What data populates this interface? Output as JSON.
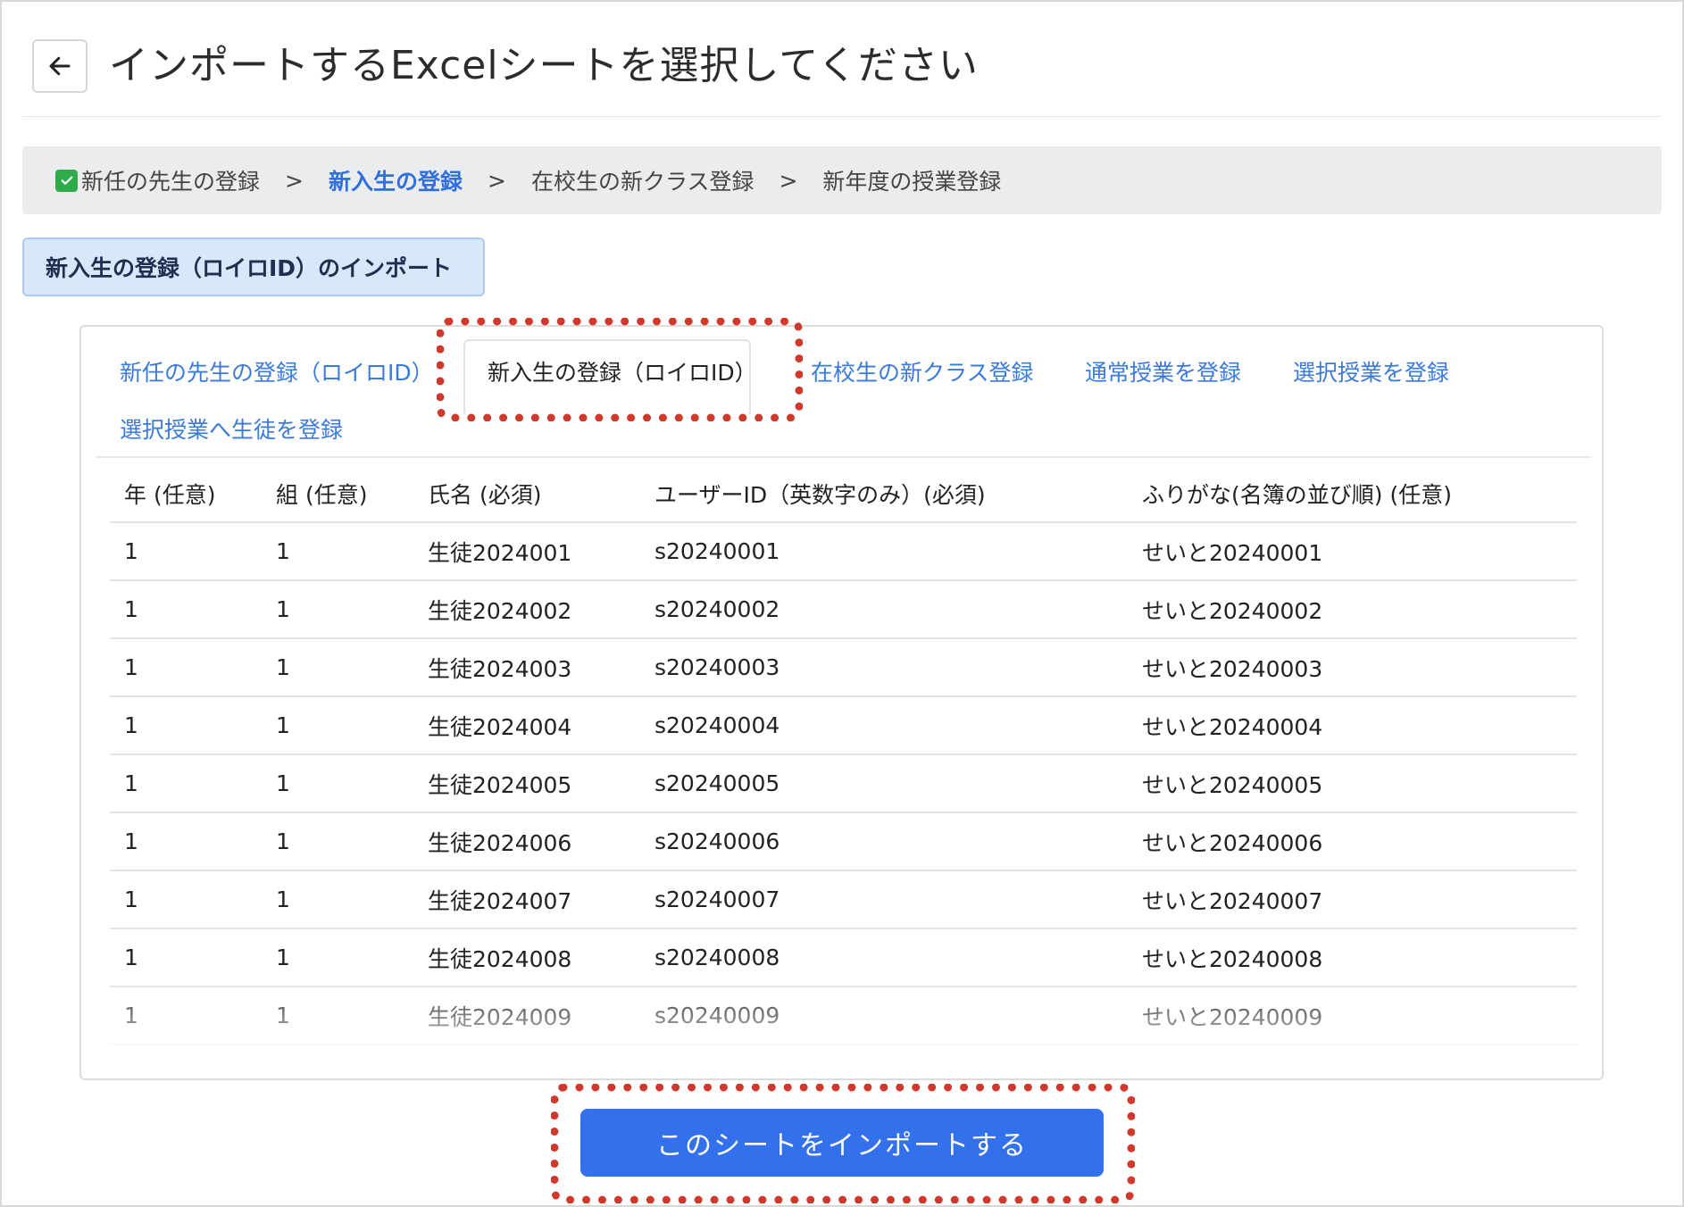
{
  "header": {
    "title": "インポートするExcelシートを選択してください"
  },
  "breadcrumb": {
    "steps": [
      {
        "label": "新任の先生の登録",
        "done": true
      },
      {
        "label": "新入生の登録",
        "active": true
      },
      {
        "label": "在校生の新クラス登録"
      },
      {
        "label": "新年度の授業登録"
      }
    ],
    "separator": ">"
  },
  "import_label": "新入生の登録（ロイロID）のインポート",
  "tabs": [
    {
      "label": "新任の先生の登録（ロイロID）"
    },
    {
      "label": "新入生の登録（ロイロID）",
      "active": true
    },
    {
      "label": "在校生の新クラス登録"
    },
    {
      "label": "通常授業を登録"
    },
    {
      "label": "選択授業を登録"
    },
    {
      "label": "選択授業へ生徒を登録"
    }
  ],
  "table": {
    "headers": [
      "年 (任意)",
      "組 (任意)",
      "氏名 (必須)",
      "ユーザーID（英数字のみ）(必須)",
      "ふりがな(名簿の並び順) (任意)"
    ],
    "rows": [
      [
        "1",
        "1",
        "生徒2024001",
        "s20240001",
        "せいと20240001"
      ],
      [
        "1",
        "1",
        "生徒2024002",
        "s20240002",
        "せいと20240002"
      ],
      [
        "1",
        "1",
        "生徒2024003",
        "s20240003",
        "せいと20240003"
      ],
      [
        "1",
        "1",
        "生徒2024004",
        "s20240004",
        "せいと20240004"
      ],
      [
        "1",
        "1",
        "生徒2024005",
        "s20240005",
        "せいと20240005"
      ],
      [
        "1",
        "1",
        "生徒2024006",
        "s20240006",
        "せいと20240006"
      ],
      [
        "1",
        "1",
        "生徒2024007",
        "s20240007",
        "せいと20240007"
      ],
      [
        "1",
        "1",
        "生徒2024008",
        "s20240008",
        "せいと20240008"
      ],
      [
        "1",
        "1",
        "生徒2024009",
        "s20240009",
        "せいと20240009"
      ]
    ]
  },
  "import_button": "このシートをインポートする",
  "colors": {
    "accent": "#3370ec",
    "link": "#3a7ad9",
    "highlight": "#d0382b",
    "done_check": "#2eab4a"
  }
}
